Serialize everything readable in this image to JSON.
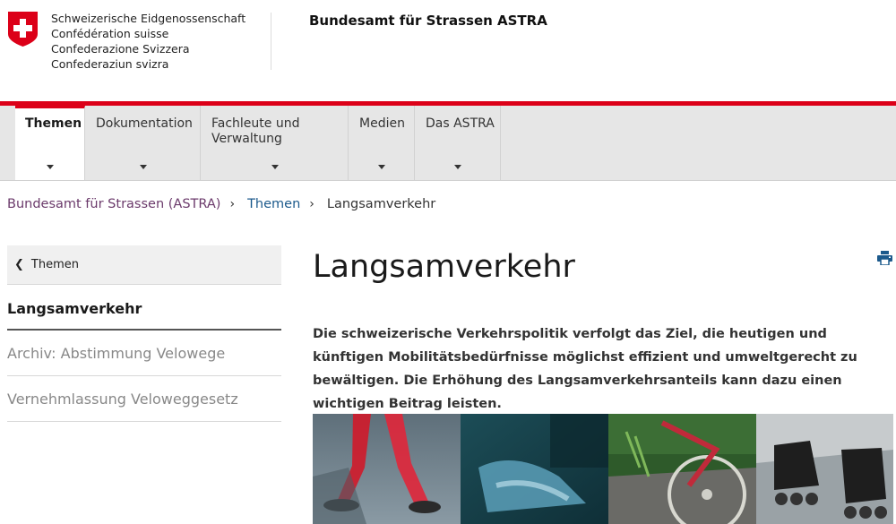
{
  "header": {
    "confederation_lines": [
      "Schweizerische Eidgenossenschaft",
      "Confédération suisse",
      "Confederazione Svizzera",
      "Confederaziun svizra"
    ],
    "office_name": "Bundesamt für Strassen ASTRA"
  },
  "nav": {
    "items": [
      {
        "label": "Themen",
        "active": true
      },
      {
        "label": "Dokumentation",
        "active": false
      },
      {
        "label": "Fachleute und Verwaltung",
        "active": false
      },
      {
        "label": "Medien",
        "active": false
      },
      {
        "label": "Das ASTRA",
        "active": false
      }
    ]
  },
  "breadcrumb": {
    "items": [
      "Bundesamt für Strassen (ASTRA)",
      "Themen",
      "Langsamverkehr"
    ]
  },
  "sidebar": {
    "back_label": "Themen",
    "items": [
      {
        "label": "Langsamverkehr",
        "current": true
      },
      {
        "label": "Archiv: Abstimmung Velowege",
        "current": false
      },
      {
        "label": "Vernehmlassung Veloweggesetz",
        "current": false
      }
    ]
  },
  "main": {
    "title": "Langsamverkehr",
    "lead": "Die schweizerische Verkehrspolitik verfolgt das Ziel, die heutigen und künftigen Mobilitätsbedürfnisse möglichst effizient und umweltgerecht zu bewältigen. Die Erhöhung des Langsamverkehrsanteils kann dazu einen wichtigen Beitrag leisten."
  },
  "colors": {
    "brand_red": "#dc0018",
    "breadcrumb_link_purple": "#6b3a6b",
    "breadcrumb_link_blue": "#1c5a8c",
    "print_icon_blue": "#1c5a8c"
  },
  "icons": [
    "swiss-flag-icon",
    "caret-down-icon",
    "chevron-left-icon",
    "chevron-right-icon",
    "print-icon"
  ]
}
